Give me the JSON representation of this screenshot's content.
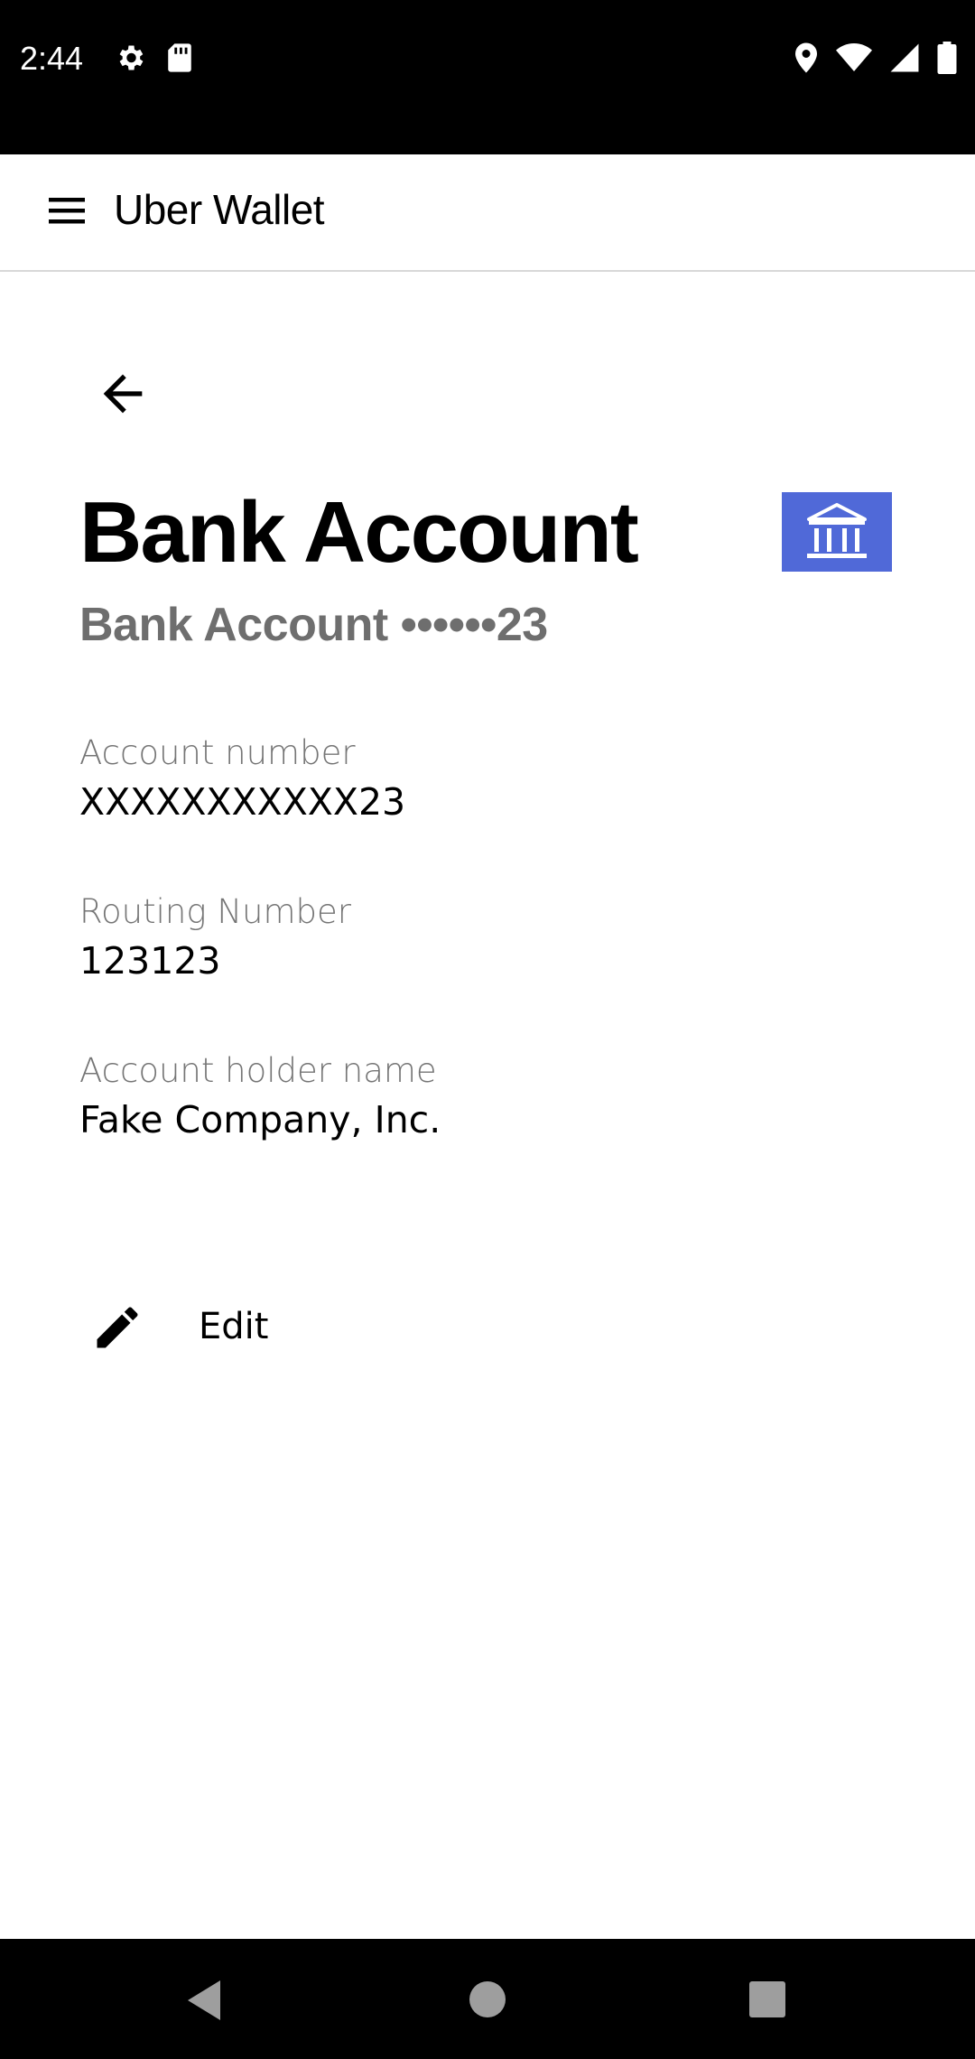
{
  "status_bar": {
    "time": "2:44",
    "icons": [
      "settings-icon",
      "sd-card-icon",
      "location-icon",
      "wifi-icon",
      "signal-icon",
      "battery-icon"
    ]
  },
  "app_bar": {
    "title": "Uber Wallet",
    "menu_icon": "hamburger-menu-icon"
  },
  "page": {
    "title": "Bank Account",
    "subtitle": "Bank Account ••••••23",
    "badge_icon": "bank-icon",
    "badge_color": "#5069d8"
  },
  "fields": [
    {
      "label": "Account number",
      "value": "XXXXXXXXXXX23"
    },
    {
      "label": "Routing Number",
      "value": "123123"
    },
    {
      "label": "Account holder name",
      "value": "Fake Company, Inc."
    }
  ],
  "actions": {
    "edit_label": "Edit"
  },
  "nav_bar": {
    "icons": [
      "back-triangle-icon",
      "home-circle-icon",
      "recents-square-icon"
    ]
  }
}
